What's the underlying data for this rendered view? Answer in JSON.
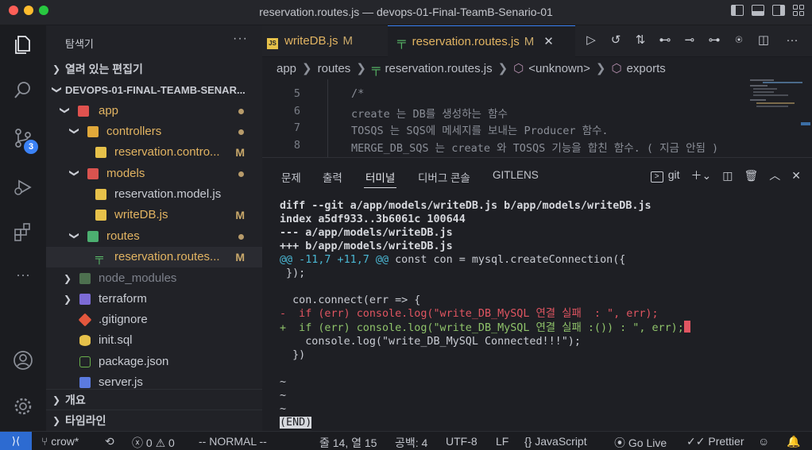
{
  "window": {
    "title": "reservation.routes.js — devops-01-Final-TeamB-Senario-01"
  },
  "activity_bar": {
    "scm_badge": "3"
  },
  "sidebar": {
    "header": "탐색기",
    "more": "···",
    "open_editors": "열려 있는 편집기",
    "project": "DEVOPS-01-FINAL-TEAMB-SENAR...",
    "tree": [
      {
        "label": "app",
        "status": "dot"
      },
      {
        "label": "controllers",
        "status": "dot"
      },
      {
        "label": "reservation.contro...",
        "status": "M"
      },
      {
        "label": "models",
        "status": "dot"
      },
      {
        "label": "reservation.model.js",
        "status": ""
      },
      {
        "label": "writeDB.js",
        "status": "M"
      },
      {
        "label": "routes",
        "status": "dot"
      },
      {
        "label": "reservation.routes...",
        "status": "M"
      },
      {
        "label": "node_modules",
        "status": ""
      },
      {
        "label": "terraform",
        "status": ""
      },
      {
        "label": ".gitignore",
        "status": ""
      },
      {
        "label": "init.sql",
        "status": ""
      },
      {
        "label": "package.json",
        "status": ""
      },
      {
        "label": "server.js",
        "status": ""
      }
    ],
    "outline": "개요",
    "timeline": "타임라인"
  },
  "tabs": [
    {
      "label": "writeDB.js",
      "modified": "M",
      "icon": "JS"
    },
    {
      "label": "reservation.routes.js",
      "modified": "M",
      "close": "✕"
    }
  ],
  "breadcrumb": [
    "app",
    "routes",
    "reservation.routes.js",
    "<unknown>",
    "exports"
  ],
  "editor": {
    "lines": [
      {
        "n": "5",
        "text": "/*"
      },
      {
        "n": "6",
        "text": "create 는 DB를 생성하는 함수"
      },
      {
        "n": "7",
        "text": "TOSQS 는 SQS에 메세지를 보내는 Producer 함수."
      },
      {
        "n": "8",
        "text": "MERGE_DB_SQS 는 create 와 TOSQS 기능을 합친 함수. ( 지금 안됨 )"
      }
    ]
  },
  "panel": {
    "tabs": [
      "문제",
      "출력",
      "터미널",
      "디버그 콘솔",
      "GITLENS"
    ],
    "active_tab": "터미널",
    "terminal_name": "git",
    "terminal": {
      "header": [
        "diff --git a/app/models/writeDB.js b/app/models/writeDB.js",
        "index a5df933..3b6061c 100644",
        "--- a/app/models/writeDB.js",
        "+++ b/app/models/writeDB.js"
      ],
      "hunk_marker": "@@ -11,7 +11,7 @@",
      "hunk_context": " const con = mysql.createConnection({",
      "ctx1": " });",
      "ctx2": "",
      "ctx3": "  con.connect(err => {",
      "deleted": "-  if (err) console.log(\"write_DB_MySQL 연결 실패  : \", err);",
      "added": "+  if (err) console.log(\"write_DB_MySQL 연결 실패 :()) : \", err);",
      "ctx4": "    console.log(\"write_DB_MySQL Connected!!!\");",
      "ctx5": "  })",
      "tilde": "~",
      "end": "(END)"
    }
  },
  "statusbar": {
    "branch": "crow*",
    "errors": "0",
    "warnings": "0",
    "vim_mode": "-- NORMAL --",
    "position": "줄 14, 열 15",
    "spaces": "공백: 4",
    "encoding": "UTF-8",
    "eol": "LF",
    "language": "JavaScript",
    "go_live": "Go Live",
    "prettier": "Prettier"
  },
  "colors": {
    "accent": "#3b82f6",
    "modified": "#c8a86a",
    "diff_add": "#8fc36a",
    "diff_del": "#e05561",
    "hunk": "#4ab7d3"
  }
}
